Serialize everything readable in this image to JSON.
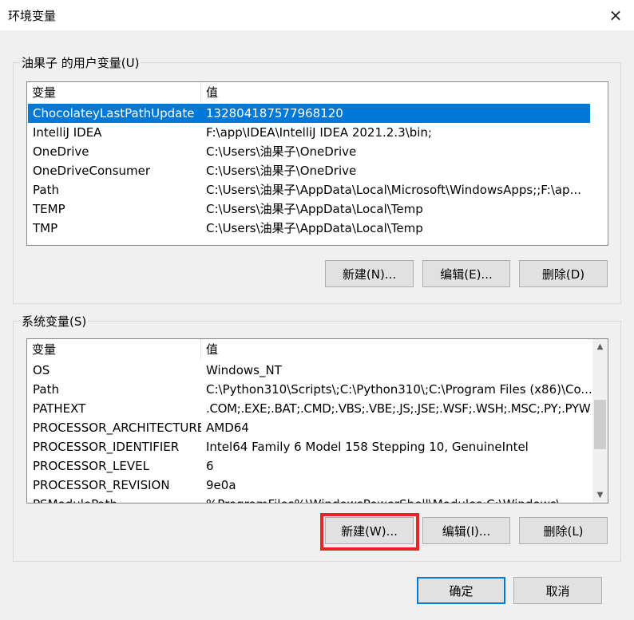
{
  "window": {
    "title": "环境变量",
    "close_icon": "×"
  },
  "user_group": {
    "legend": "油果子 的用户变量(U)",
    "columns": [
      "变量",
      "值"
    ],
    "rows": [
      {
        "name": "ChocolateyLastPathUpdate",
        "value": "132804187577968120"
      },
      {
        "name": "IntelliJ IDEA",
        "value": "F:\\app\\IDEA\\IntelliJ IDEA 2021.2.3\\bin;"
      },
      {
        "name": "OneDrive",
        "value": "C:\\Users\\油果子\\OneDrive"
      },
      {
        "name": "OneDriveConsumer",
        "value": "C:\\Users\\油果子\\OneDrive"
      },
      {
        "name": "Path",
        "value": "C:\\Users\\油果子\\AppData\\Local\\Microsoft\\WindowsApps;;F:\\ap..."
      },
      {
        "name": "TEMP",
        "value": "C:\\Users\\油果子\\AppData\\Local\\Temp"
      },
      {
        "name": "TMP",
        "value": "C:\\Users\\油果子\\AppData\\Local\\Temp"
      }
    ],
    "selected_row": "ChocolateyLastPathUpdate",
    "buttons": {
      "new": "新建(N)...",
      "edit": "编辑(E)...",
      "delete": "删除(D)"
    }
  },
  "system_group": {
    "legend": "系统变量(S)",
    "columns": [
      "变量",
      "值"
    ],
    "rows": [
      {
        "name": "OS",
        "value": "Windows_NT"
      },
      {
        "name": "Path",
        "value": "C:\\Python310\\Scripts\\;C:\\Python310\\;C:\\Program Files (x86)\\Co..."
      },
      {
        "name": "PATHEXT",
        "value": ".COM;.EXE;.BAT;.CMD;.VBS;.VBE;.JS;.JSE;.WSF;.WSH;.MSC;.PY;.PYW"
      },
      {
        "name": "PROCESSOR_ARCHITECTURE",
        "value": "AMD64"
      },
      {
        "name": "PROCESSOR_IDENTIFIER",
        "value": "Intel64 Family 6 Model 158 Stepping 10, GenuineIntel"
      },
      {
        "name": "PROCESSOR_LEVEL",
        "value": "6"
      },
      {
        "name": "PROCESSOR_REVISION",
        "value": "9e0a"
      },
      {
        "name": "PSModulePath",
        "value": "%ProgramFiles%\\WindowsPowerShell\\Modules;C:\\Windows\\..."
      }
    ],
    "buttons": {
      "new": "新建(W)...",
      "edit": "编辑(I)...",
      "delete": "删除(L)"
    }
  },
  "footer": {
    "ok": "确定",
    "cancel": "取消"
  },
  "colors": {
    "selection": "#0078d7",
    "highlight": "#e8242b"
  }
}
